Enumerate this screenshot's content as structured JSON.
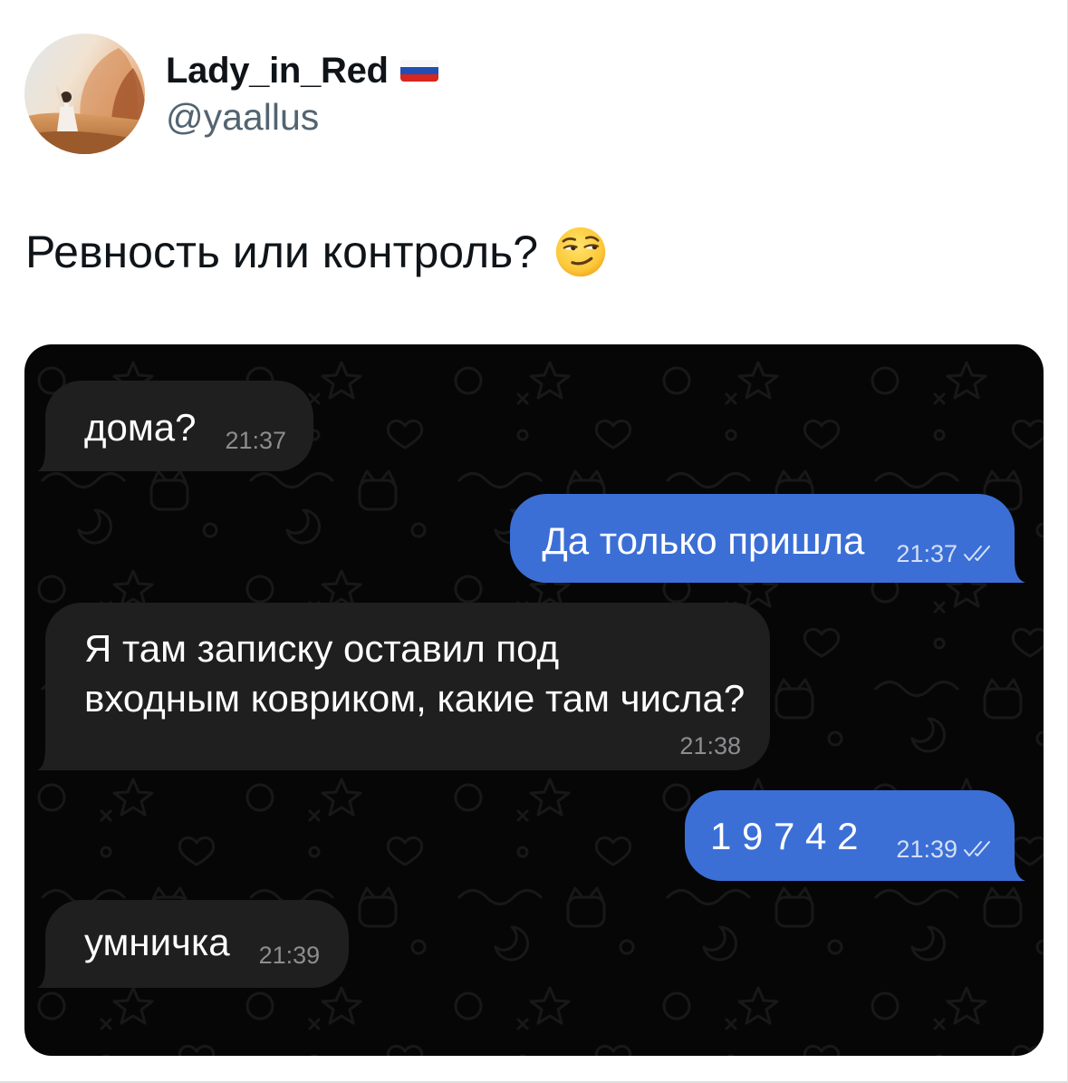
{
  "tweet": {
    "author": {
      "display_name": "Lady_in_Red",
      "handle": "@yaallus",
      "avatar_icon": "avatar-photo",
      "flag_icon": "russian-flag-icon"
    },
    "text": "Ревность или контроль?",
    "emoji_icon": "smirking-face-emoji-icon"
  },
  "chat": {
    "colors": {
      "background": "#060606",
      "incoming_bubble": "#1f1f20",
      "outgoing_bubble": "#3b6fd6",
      "incoming_time": "#8d8d8f"
    },
    "messages": [
      {
        "outgoing": false,
        "text": "дома?",
        "time": "21:37"
      },
      {
        "outgoing": true,
        "text": "Да только пришла",
        "time": "21:37",
        "status_icon": "double-check-icon"
      },
      {
        "outgoing": false,
        "lines": [
          "Я там записку оставил под",
          "входным ковриком, какие там числа?"
        ],
        "time": "21:38"
      },
      {
        "outgoing": true,
        "text": "1 9 7 4 2",
        "time": "21:39",
        "status_icon": "double-check-icon"
      },
      {
        "outgoing": false,
        "text": "умничка",
        "time": "21:39"
      }
    ]
  }
}
